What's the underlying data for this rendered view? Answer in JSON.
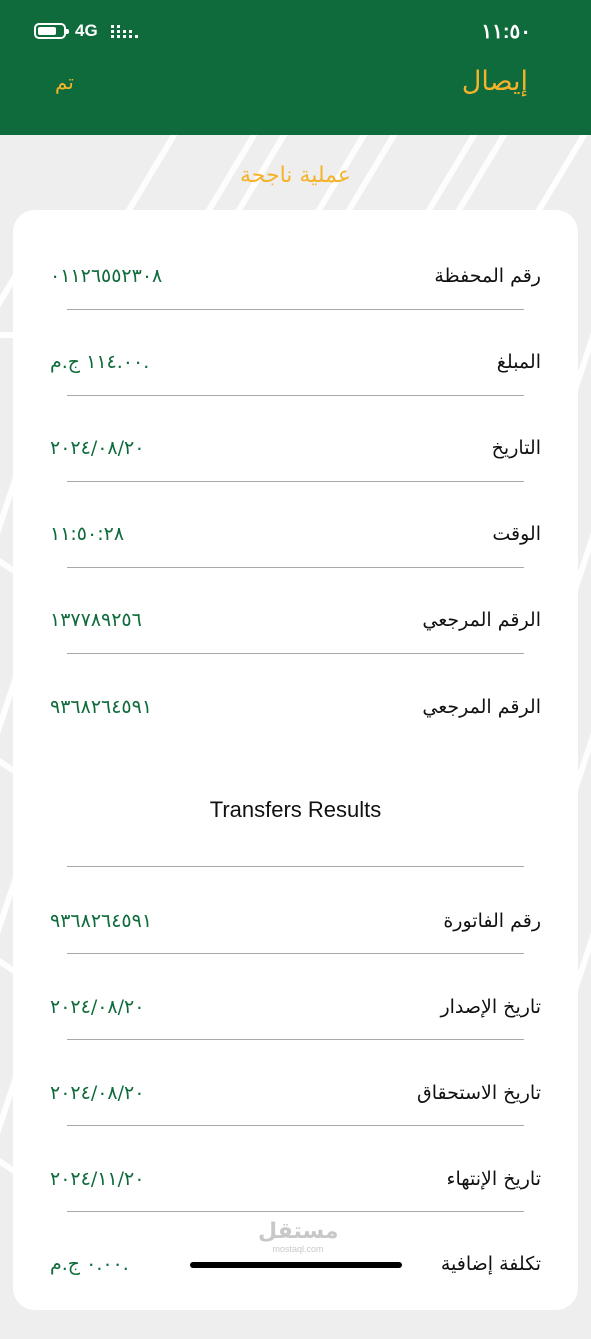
{
  "status_bar": {
    "time": "١١:٥٠",
    "network": "4G",
    "battery_icon": "battery-icon",
    "signal_icon": "signal-icon"
  },
  "header": {
    "title": "إيصال",
    "done_label": "تم"
  },
  "colors": {
    "brand_green": "#0f6b3b",
    "accent_orange": "#f4b32a"
  },
  "status_message": "عملية ناجحة",
  "details": [
    {
      "label": "رقم المحفظة",
      "value": "٠١١٢٦٥٥٢٣٠٨"
    },
    {
      "label": "المبلغ",
      "value": "١١٤.٠٠ ج.م."
    },
    {
      "label": "التاريخ",
      "value": "٢٠٢٤/٠٨/٢٠"
    },
    {
      "label": "الوقت",
      "value": "١١:٥٠:٢٨"
    },
    {
      "label": "الرقم المرجعي",
      "value": "١٣٧٧٨٩٢٥٦"
    },
    {
      "label": "الرقم المرجعي",
      "value": "٩٣٦٨٢٦٤٥٩١"
    }
  ],
  "transfers_section": {
    "title": "Transfers Results",
    "rows": [
      {
        "label": "رقم الفاتورة",
        "value": "٩٣٦٨٢٦٤٥٩١"
      },
      {
        "label": "تاريخ الإصدار",
        "value": "٢٠٢٤/٠٨/٢٠"
      },
      {
        "label": "تاريخ الاستحقاق",
        "value": "٢٠٢٤/٠٨/٢٠"
      },
      {
        "label": "تاريخ الإنتهاء",
        "value": "٢٠٢٤/١١/٢٠"
      },
      {
        "label": "تكلفة إضافية",
        "value": "٠.٠٠ ج.م."
      }
    ]
  },
  "watermark": {
    "main": "مستقل",
    "sub": "mostaql.com"
  }
}
